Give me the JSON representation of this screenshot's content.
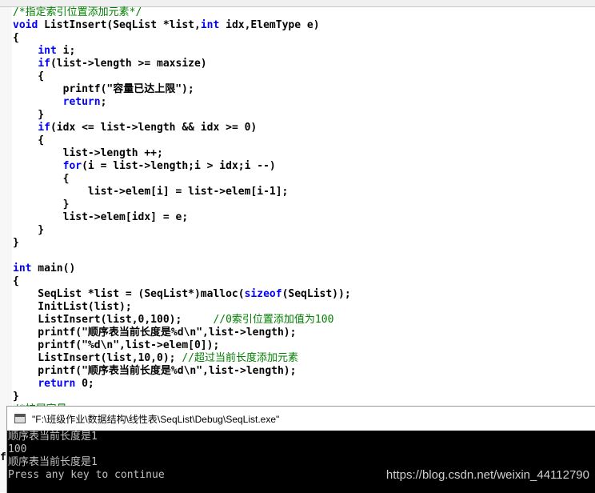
{
  "colors": {
    "keyword": "#0000ff",
    "comment": "#008000",
    "text": "#000000",
    "console_bg": "#000000",
    "console_text": "#c0c0c0"
  },
  "editor": {
    "lines": [
      [
        [
          "cm",
          "/*指定索引位置添加元素*/"
        ]
      ],
      [
        [
          "kw",
          "void"
        ],
        [
          "tx",
          " ListInsert(SeqList *list,"
        ],
        [
          "kw",
          "int"
        ],
        [
          "tx",
          " idx,ElemType e)"
        ]
      ],
      [
        [
          "tx",
          "{"
        ]
      ],
      [
        [
          "tx",
          "    "
        ],
        [
          "kw",
          "int"
        ],
        [
          "tx",
          " i;"
        ]
      ],
      [
        [
          "tx",
          "    "
        ],
        [
          "kw",
          "if"
        ],
        [
          "tx",
          "(list->length >= maxsize)"
        ]
      ],
      [
        [
          "tx",
          "    {"
        ]
      ],
      [
        [
          "tx",
          "        printf(\"容量已达上限\");"
        ]
      ],
      [
        [
          "tx",
          "        "
        ],
        [
          "kw",
          "return"
        ],
        [
          "tx",
          ";"
        ]
      ],
      [
        [
          "tx",
          "    }"
        ]
      ],
      [
        [
          "tx",
          "    "
        ],
        [
          "kw",
          "if"
        ],
        [
          "tx",
          "(idx <= list->length && idx >= 0)"
        ]
      ],
      [
        [
          "tx",
          "    {"
        ]
      ],
      [
        [
          "tx",
          "        list->length ++;"
        ]
      ],
      [
        [
          "tx",
          "        "
        ],
        [
          "kw",
          "for"
        ],
        [
          "tx",
          "(i = list->length;i > idx;i --)"
        ]
      ],
      [
        [
          "tx",
          "        {"
        ]
      ],
      [
        [
          "tx",
          "            list->elem[i] = list->elem[i-1];"
        ]
      ],
      [
        [
          "tx",
          "        }"
        ]
      ],
      [
        [
          "tx",
          "        list->elem[idx] = e;"
        ]
      ],
      [
        [
          "tx",
          "    }"
        ]
      ],
      [
        [
          "tx",
          "}"
        ]
      ],
      [
        [
          "tx",
          ""
        ]
      ],
      [
        [
          "kw",
          "int"
        ],
        [
          "tx",
          " main()"
        ]
      ],
      [
        [
          "tx",
          "{"
        ]
      ],
      [
        [
          "tx",
          "    SeqList *list = (SeqList*)malloc("
        ],
        [
          "kw",
          "sizeof"
        ],
        [
          "tx",
          "(SeqList));"
        ]
      ],
      [
        [
          "tx",
          "    InitList(list);"
        ]
      ],
      [
        [
          "tx",
          "    ListInsert(list,0,100);     "
        ],
        [
          "cm",
          "//0索引位置添加值为100"
        ]
      ],
      [
        [
          "tx",
          "    printf(\"顺序表当前长度是%d\\n\",list->length);"
        ]
      ],
      [
        [
          "tx",
          "    printf(\"%d\\n\",list->elem[0]);"
        ]
      ],
      [
        [
          "tx",
          "    ListInsert(list,10,0); "
        ],
        [
          "cm",
          "//超过当前长度添加元素"
        ]
      ],
      [
        [
          "tx",
          "    printf(\"顺序表当前长度是%d\\n\",list->length);"
        ]
      ],
      [
        [
          "tx",
          "    "
        ],
        [
          "kw",
          "return"
        ],
        [
          "tx",
          " 0;"
        ]
      ],
      [
        [
          "tx",
          "}"
        ]
      ],
      [
        [
          "cm",
          "/*扩展容量"
        ]
      ]
    ]
  },
  "left_stub": "f",
  "console": {
    "title": "\"F:\\班级作业\\数据结构\\线性表\\SeqList\\Debug\\SeqList.exe\"",
    "output": [
      "顺序表当前长度是1",
      "100",
      "顺序表当前长度是1",
      "Press any key to continue"
    ],
    "watermark": "https://blog.csdn.net/weixin_44112790"
  }
}
